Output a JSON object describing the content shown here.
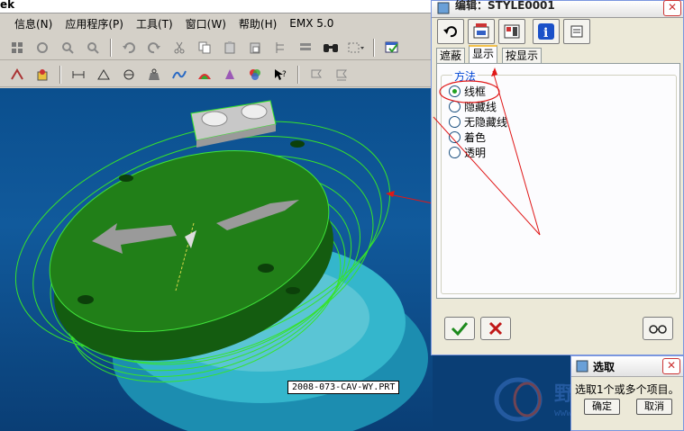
{
  "app": {
    "title_fragment": "ek",
    "version_label": "EMX 5.0"
  },
  "menu": [
    {
      "label": "信息(N)"
    },
    {
      "label": "应用程序(P)"
    },
    {
      "label": "工具(T)"
    },
    {
      "label": "窗口(W)"
    },
    {
      "label": "帮助(H)"
    }
  ],
  "viewport": {
    "model_file": "2008-073-CAV-WY.PRT",
    "background_top": "#0b4f8e",
    "model_color": "#1f7a16",
    "wire_color": "#36e02a"
  },
  "dialog": {
    "title": "编辑：STYLE0001",
    "close_icon": "close-icon",
    "tabs": [
      {
        "label": "遮蔽",
        "active": false
      },
      {
        "label": "显示",
        "active": true
      },
      {
        "label": "按显示",
        "active": false
      }
    ],
    "method": {
      "legend": "方法",
      "options": [
        {
          "label": "线框",
          "checked": true
        },
        {
          "label": "隐藏线",
          "checked": false
        },
        {
          "label": "无隐藏线",
          "checked": false
        },
        {
          "label": "着色",
          "checked": false
        },
        {
          "label": "透明",
          "checked": false
        }
      ]
    },
    "ok_icon": "checkmark-icon",
    "cancel_icon": "x-icon",
    "preview_icon": "glasses-icon"
  },
  "select_dialog": {
    "title": "选取",
    "message": "选取1个或多个项目。",
    "ok_label": "确定",
    "cancel_label": "取消"
  },
  "watermark": {
    "text": "野火论坛",
    "url": "www.proewildfire.cn"
  },
  "annotation_color": "#e01818"
}
